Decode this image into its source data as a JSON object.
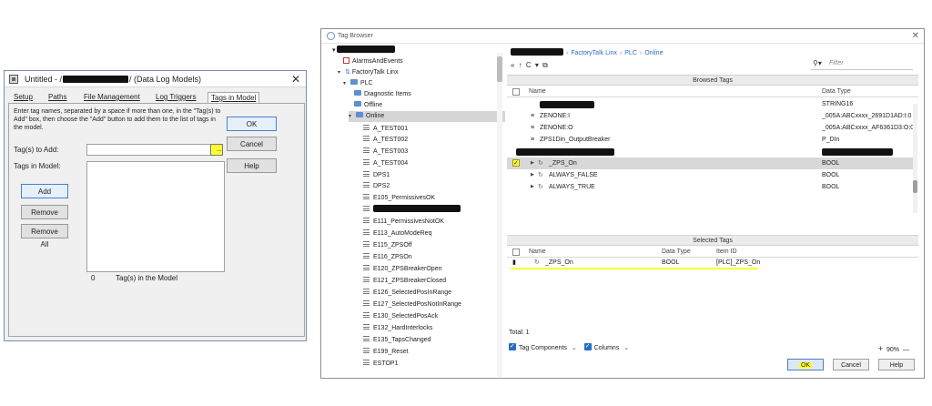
{
  "dialog": {
    "title_prefix": "Untitled - /",
    "title_suffix": "/ (Data Log Models)",
    "close_glyph": "✕",
    "tabs": [
      "Setup",
      "Paths",
      "File Management",
      "Log Triggers",
      "Tags in Model"
    ],
    "instructions": "Enter tag names, separated by a space if more than one, in the \"Tag(s) to Add\" box, then choose the \"Add\" button to add them to the list of tags in the model.",
    "tag_to_add_label": "Tag(s) to Add:",
    "tag_to_add_value": "",
    "browse_label": "...",
    "tags_in_model_label": "Tags in Model:",
    "ok": "OK",
    "cancel": "Cancel",
    "help": "Help",
    "add": "Add",
    "remove": "Remove",
    "remove_all": "Remove All",
    "tag_count": "0",
    "tag_count_label": "Tag(s) in the Model"
  },
  "tag_browser": {
    "title": "Tag Browser",
    "close_glyph": "✕",
    "tree": {
      "root_prefix": "▾ ",
      "alarms": "AlarmsAndEvents",
      "ftlinx": "FactoryTalk Linx",
      "plc": "PLC",
      "diag": "Diagnostic Items",
      "offline": "Offline",
      "online": "Online",
      "tags_a": [
        "A_TEST001",
        "A_TEST002",
        "A_TEST003",
        "A_TEST004",
        "DPS1",
        "DPS2",
        "E105_PermissivesOK"
      ],
      "tags_b": [
        "E111_PermissivesNotOK",
        "E113_AutoModeReq",
        "E115_ZPSOff",
        "E116_ZPSOn",
        "E120_ZPSBreakerOpen",
        "E121_ZPSBreakerClosed",
        "E126_SelectedPosInRange",
        "E127_SelectedPosNotInRange",
        "E130_SelectedPosAck",
        "E132_HardInterlocks",
        "E135_TapsChanged",
        "E199_Reset",
        "ESTOP1"
      ]
    },
    "breadcrumb": {
      "ftlinx": "FactoryTalk Linx",
      "plc": "PLC",
      "online": "Online"
    },
    "toolbar_glyphs": "« ↑ C ▾ ⧉",
    "filter_placeholder": "Filter",
    "browsed_header": "Browsed Tags",
    "col_name": "Name",
    "col_datatype": "Data Type",
    "browsed_rows": [
      {
        "name": "ZENONE:I",
        "type": "_005A:ABCxxxx_2691D1AD:I:0"
      },
      {
        "name": "ZENONE:O",
        "type": "_005A:ABCxxxx_AF6361D3:O:0"
      },
      {
        "name": "ZPS1Din_OutputBreaker",
        "type": "P_DIn"
      }
    ],
    "row_string_type": "STRING16",
    "zps_on": {
      "name": "_ZPS_On",
      "type": "BOOL"
    },
    "always_false": {
      "name": "ALWAYS_FALSE",
      "type": "BOOL"
    },
    "always_true": {
      "name": "ALWAYS_TRUE",
      "type": "BOOL"
    },
    "selected_header": "Selected Tags",
    "col_item_id": "Item ID",
    "selected_row": {
      "name": "_ZPS_On",
      "type": "BOOL",
      "item_id": "[PLC]_ZPS_On"
    },
    "total": "Total: 1",
    "tag_components": "Tag Components",
    "columns": "Columns",
    "zoom": "90%",
    "plus": "+",
    "minus": "—",
    "ok": "OK",
    "cancel": "Cancel",
    "help": "Help"
  },
  "colors": {
    "highlight": "#ffff33",
    "link": "#2a6cc1"
  }
}
